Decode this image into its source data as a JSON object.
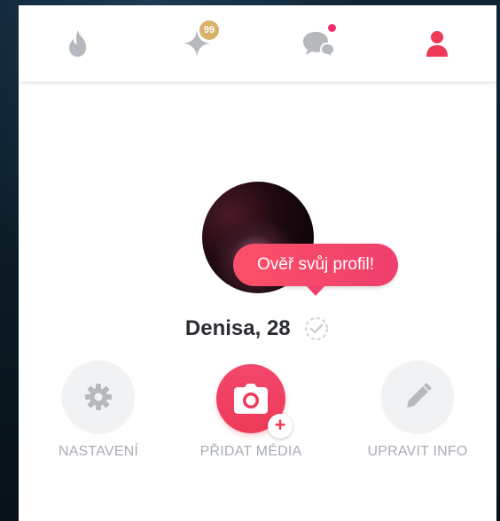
{
  "navbar": {
    "items": [
      {
        "name": "flame",
        "icon": "flame-icon"
      },
      {
        "name": "explore",
        "icon": "sparkle-icon",
        "badge": "99"
      },
      {
        "name": "messages",
        "icon": "chat-bubbles-icon",
        "has_dot": true
      },
      {
        "name": "profile",
        "icon": "profile-person-icon",
        "active": true
      }
    ]
  },
  "profile": {
    "tooltip": "Ověř svůj profil!",
    "name_age": "Denisa, 28",
    "verified_icon": "verify-check-icon"
  },
  "actions": {
    "settings_label": "NASTAVENÍ",
    "add_media_label": "PŘIDAT MÉDIA",
    "edit_info_label": "UPRAVIT INFO",
    "add_media_plus": "+"
  },
  "colors": {
    "accent": "#ee3a57",
    "badge_gold": "#d9b26a",
    "icon_grey": "#b5b8bd",
    "label_grey": "#a8adb4",
    "name_text": "#2a2d33"
  }
}
